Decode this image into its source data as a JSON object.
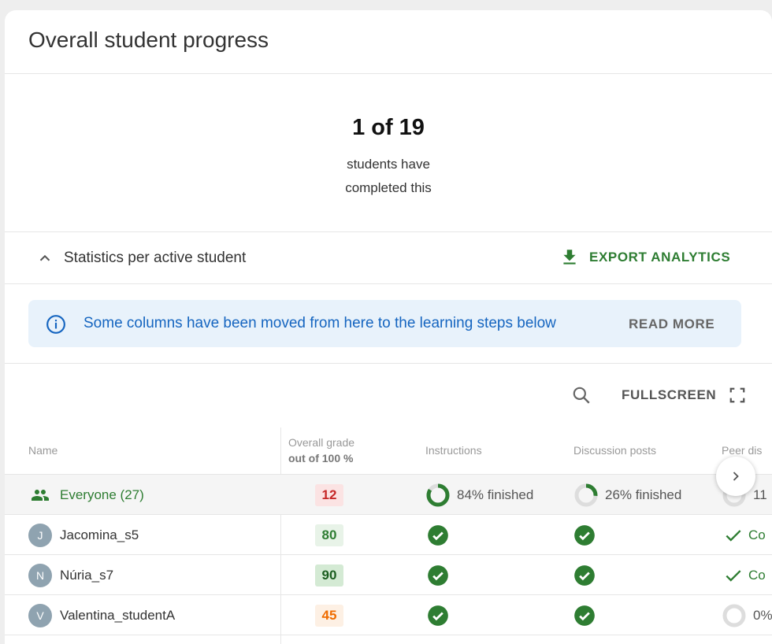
{
  "card": {
    "title": "Overall student progress"
  },
  "summary": {
    "count": "1 of 19",
    "line1": "students have",
    "line2": "completed this"
  },
  "section": {
    "label": "Statistics per active student",
    "export_label": "EXPORT ANALYTICS"
  },
  "banner": {
    "text": "Some columns have been moved from here to the learning steps below",
    "action": "READ MORE"
  },
  "toolbar": {
    "fullscreen_label": "FULLSCREEN"
  },
  "columns": {
    "name": "Name",
    "grade_title": "Overall grade",
    "grade_sub": "out of 100 %",
    "instructions": "Instructions",
    "discussion": "Discussion posts",
    "peer": "Peer dis"
  },
  "colors": {
    "accent_green": "#2e7d32",
    "info_blue": "#1565c0",
    "danger": "#c62828",
    "warning": "#ef6c00"
  },
  "rows": [
    {
      "name": "Everyone (27)",
      "grade": "12",
      "grade_status": "low",
      "instructions": "84% finished",
      "instructions_pct": 84,
      "discussion": "26% finished",
      "discussion_pct": 26,
      "peer": "11"
    },
    {
      "avatar": "J",
      "name": "Jacomina_s5",
      "grade": "80",
      "grade_status": "good",
      "instructions": "done",
      "discussion": "done",
      "peer": "Co"
    },
    {
      "avatar": "N",
      "name": "Núria_s7",
      "grade": "90",
      "grade_status": "great",
      "instructions": "done",
      "discussion": "done",
      "peer": "Co"
    },
    {
      "avatar": "V",
      "name": "Valentina_studentA",
      "grade": "45",
      "grade_status": "medium",
      "instructions": "done",
      "discussion": "done",
      "peer": "0%"
    }
  ]
}
